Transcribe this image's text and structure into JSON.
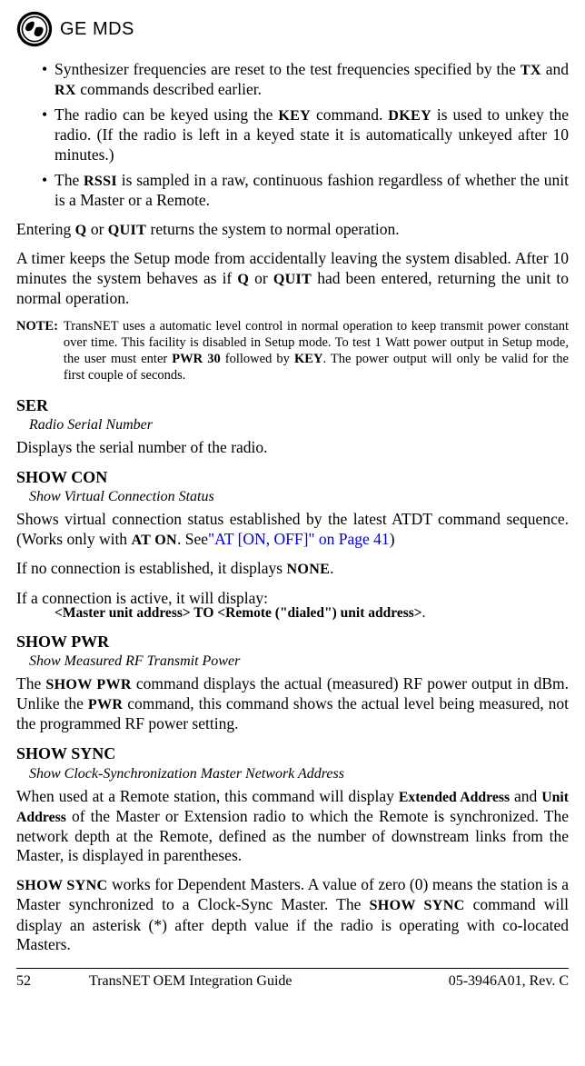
{
  "header": {
    "brand": "GE MDS"
  },
  "bullets": [
    {
      "pre": "Synthesizer frequencies are reset to the test frequencies specified by the ",
      "sc1": "TX",
      "mid1": " and ",
      "sc2": "RX",
      "post": " commands described earlier."
    },
    {
      "pre": "The radio can be keyed using the ",
      "sc1": "KEY",
      "mid1": " command. ",
      "sc2": "DKEY",
      "post": " is used to unkey the radio. (If the radio is left in a keyed state it is automatically unkeyed after 10 minutes.)"
    },
    {
      "pre": "The ",
      "sc1": "RSSI",
      "post": " is sampled in a raw, continuous fashion regardless of whether the unit is a Master or a Remote."
    }
  ],
  "para_quit": {
    "pre": "Entering ",
    "sc1": "Q",
    "mid1": " or ",
    "sc2": "QUIT",
    "post": " returns the system to normal operation."
  },
  "para_timer": {
    "pre": "A timer keeps the Setup mode from accidentally leaving the system disabled. After 10 minutes the system behaves as if ",
    "sc1": "Q",
    "mid1": " or ",
    "sc2": "QUIT",
    "post": " had been entered, returning the unit to normal operation."
  },
  "note": {
    "label": "NOTE:",
    "pre": "TransNET uses a automatic level control in normal operation to keep transmit power constant over time. This facility is disabled in Setup mode. To test 1 Watt power output in Setup mode, the user must enter ",
    "b1": "PWR 30",
    "mid1": " followed by ",
    "b2": "KEY",
    "post": ". The power output will only be valid for the first couple of seconds."
  },
  "ser": {
    "head": "SER",
    "sub": "Radio Serial Number",
    "body": "Displays the serial number of the radio."
  },
  "showcon": {
    "head": "SHOW CON",
    "sub": "Show Virtual Connection Status",
    "p1_pre": "Shows virtual connection status established by the latest ATDT command sequence. (Works only with ",
    "p1_sc": "AT ON",
    "p1_mid": ". See",
    "p1_link": "\"AT [ON, OFF]\" on Page 41",
    "p1_post": ")",
    "p2_pre": "If no connection is established, it displays ",
    "p2_sc": "NONE",
    "p2_post": ".",
    "p3": "If a connection is active, it will display:",
    "p3_line": "<Master unit address> TO <Remote (\"dialed\") unit address>",
    "p3_line_post": "."
  },
  "showpwr": {
    "head": "SHOW PWR",
    "sub": "Show Measured RF Transmit Power",
    "p_pre": "The ",
    "p_sc1": "SHOW PWR",
    "p_mid1": " command displays the actual (measured) RF power output in dBm. Unlike the ",
    "p_sc2": "PWR",
    "p_post": " command, this command shows the actual level being measured, not the programmed RF power setting."
  },
  "showsync": {
    "head": "SHOW SYNC",
    "sub": "Show Clock-Synchronization Master Network Address",
    "p1_pre": "When used at a Remote station, this command will display ",
    "p1_b1": "Extended Address",
    "p1_mid1": " and ",
    "p1_b2": "Unit Address",
    "p1_post": " of the Master or Extension radio to which the Remote is synchronized. The network depth at the Remote, defined as the number of downstream links from the Master, is displayed in parentheses.",
    "p2_sc1": "SHOW SYNC",
    "p2_mid1": " works for Dependent Masters. A value of zero (0) means the station is a Master synchronized to a Clock-Sync Master. The ",
    "p2_sc2": "SHOW SYNC",
    "p2_post": " command will display an asterisk (*) after depth value if the radio is operating with co-located Masters."
  },
  "footer": {
    "page": "52",
    "title": "TransNET OEM Integration Guide",
    "rev": "05-3946A01, Rev. C"
  }
}
